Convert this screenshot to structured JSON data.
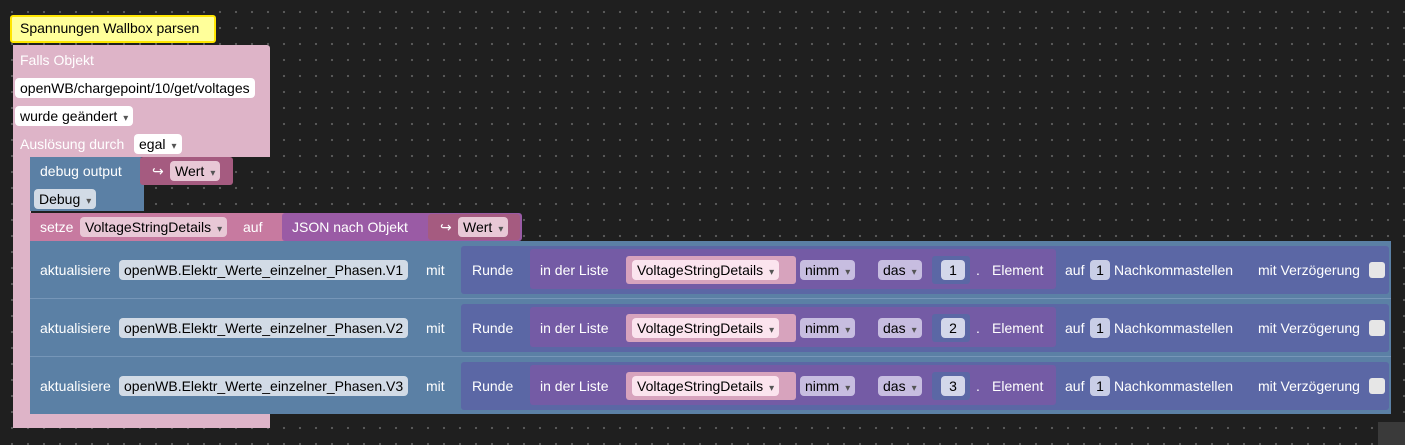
{
  "comment": "Spannungen Wallbox parsen",
  "trigger": {
    "title": "Falls Objekt",
    "object_id": "openWB/chargepoint/10/get/voltages",
    "condition": "wurde geändert",
    "trigger_label": "Auslösung durch",
    "trigger_value": "egal"
  },
  "debug": {
    "label": "debug output",
    "arrow": "↪",
    "value_label": "Wert",
    "level": "Debug"
  },
  "set": {
    "label": "setze",
    "variable": "VoltageStringDetails",
    "to_label": "auf",
    "json_label": "JSON nach Objekt",
    "arrow": "↪",
    "value_label": "Wert"
  },
  "updates": [
    {
      "label": "aktualisiere",
      "object": "openWB.Elektr_Werte_einzelner_Phasen.V1",
      "with_label": "mit",
      "round_label": "Runde",
      "in_list_label": "in der Liste",
      "list_var": "VoltageStringDetails",
      "take_label": "nimm",
      "pos_label": "das",
      "index": "1",
      "dot": ".",
      "element_label": "Element",
      "on_label": "auf",
      "decimals": "1",
      "decimals_label": "Nachkommastellen",
      "delay_label": "mit Verzögerung"
    },
    {
      "label": "aktualisiere",
      "object": "openWB.Elektr_Werte_einzelner_Phasen.V2",
      "with_label": "mit",
      "round_label": "Runde",
      "in_list_label": "in der Liste",
      "list_var": "VoltageStringDetails",
      "take_label": "nimm",
      "pos_label": "das",
      "index": "2",
      "dot": ".",
      "element_label": "Element",
      "on_label": "auf",
      "decimals": "1",
      "decimals_label": "Nachkommastellen",
      "delay_label": "mit Verzögerung"
    },
    {
      "label": "aktualisiere",
      "object": "openWB.Elektr_Werte_einzelner_Phasen.V3",
      "with_label": "mit",
      "round_label": "Runde",
      "in_list_label": "in der Liste",
      "list_var": "VoltageStringDetails",
      "take_label": "nimm",
      "pos_label": "das",
      "index": "3",
      "dot": ".",
      "element_label": "Element",
      "on_label": "auf",
      "decimals": "1",
      "decimals_label": "Nachkommastellen",
      "delay_label": "mit Verzögerung"
    }
  ],
  "colors": {
    "trigger": "#deb4c8",
    "system": "#5b80a5",
    "list": "#745ba5",
    "math": "#5b67a5",
    "json": "#9a5ba5",
    "variable": "#a55b80",
    "canvas": "#1f1f1f"
  }
}
